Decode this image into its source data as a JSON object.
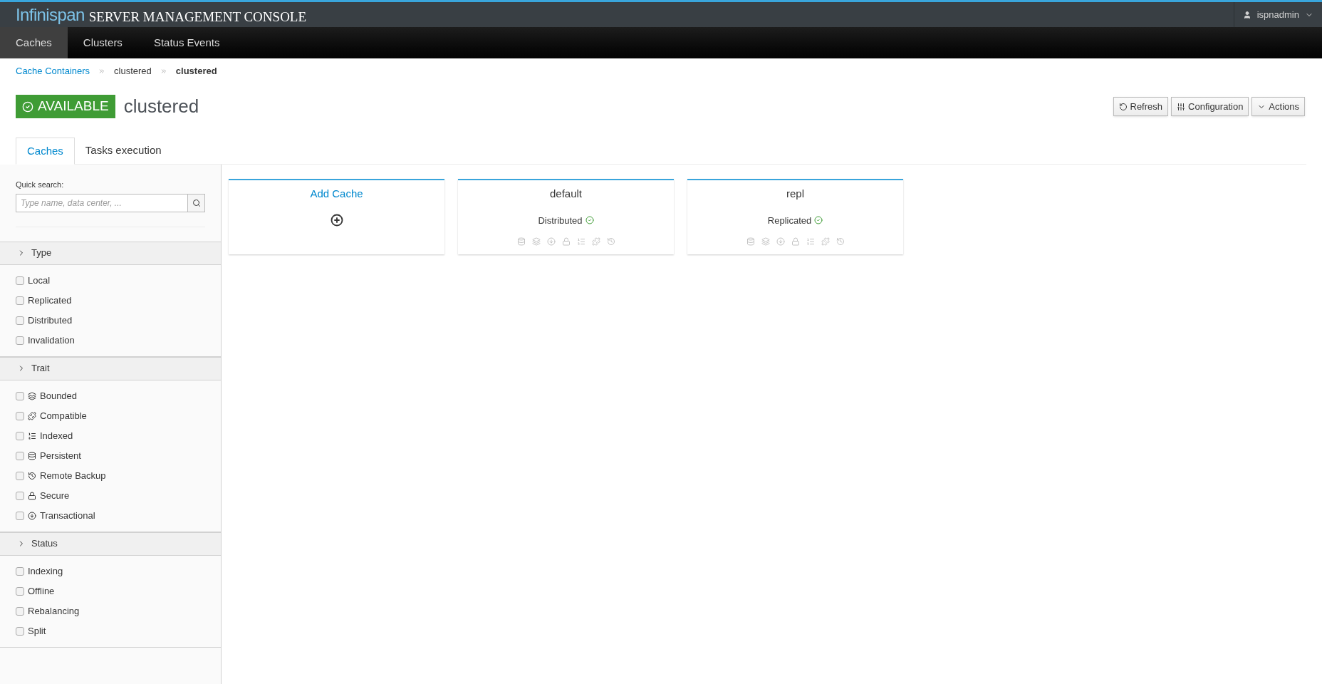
{
  "brand": {
    "logo": "Infinispan",
    "title": "SERVER MANAGEMENT CONSOLE"
  },
  "user": {
    "name": "ispnadmin"
  },
  "nav": [
    {
      "label": "Caches",
      "selected": true
    },
    {
      "label": "Clusters",
      "selected": false
    },
    {
      "label": "Status Events",
      "selected": false
    }
  ],
  "breadcrumb": [
    {
      "label": "Cache Containers",
      "kind": "link"
    },
    {
      "label": "clustered",
      "kind": "plain"
    },
    {
      "label": "clustered",
      "kind": "current"
    }
  ],
  "status_badge": "AVAILABLE",
  "page_title": "clustered",
  "actions": [
    {
      "label": "Refresh",
      "kind": "refresh"
    },
    {
      "label": "Configuration",
      "kind": "config"
    },
    {
      "label": "Actions",
      "kind": "dropdown"
    }
  ],
  "tabs": [
    {
      "label": "Caches",
      "selected": true
    },
    {
      "label": "Tasks execution",
      "selected": false
    }
  ],
  "sidebar": {
    "search_label": "Quick search:",
    "search_placeholder": "Type name, data center, ...",
    "groups": [
      {
        "title": "Type",
        "items": [
          {
            "label": "Local",
            "checked": false
          },
          {
            "label": "Replicated",
            "checked": false
          },
          {
            "label": "Distributed",
            "checked": false
          },
          {
            "label": "Invalidation",
            "checked": false
          }
        ]
      },
      {
        "title": "Trait",
        "items": [
          {
            "label": "Bounded",
            "checked": false,
            "kind": "bounded"
          },
          {
            "label": "Compatible",
            "checked": false,
            "kind": "compatible"
          },
          {
            "label": "Indexed",
            "checked": false,
            "kind": "indexed"
          },
          {
            "label": "Persistent",
            "checked": false,
            "kind": "persistent"
          },
          {
            "label": "Remote Backup",
            "checked": false,
            "kind": "backup"
          },
          {
            "label": "Secure",
            "checked": false,
            "kind": "secure"
          },
          {
            "label": "Transactional",
            "checked": false,
            "kind": "transactional"
          }
        ]
      },
      {
        "title": "Status",
        "items": [
          {
            "label": "Indexing",
            "checked": false
          },
          {
            "label": "Offline",
            "checked": false
          },
          {
            "label": "Rebalancing",
            "checked": false
          },
          {
            "label": "Split",
            "checked": false
          }
        ]
      }
    ]
  },
  "cards": [
    {
      "kind": "add",
      "title": "Add Cache"
    },
    {
      "kind": "cache",
      "title": "default",
      "type": "Distributed"
    },
    {
      "kind": "cache",
      "title": "repl",
      "type": "Replicated"
    }
  ]
}
